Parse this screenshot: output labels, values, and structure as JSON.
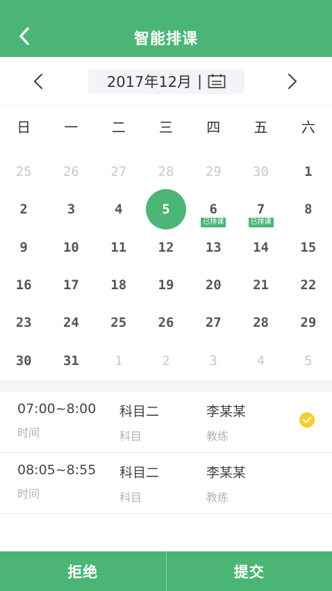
{
  "header": {
    "title": "智能排课"
  },
  "month_bar": {
    "year_month": "2017年12月",
    "separator": "|"
  },
  "weekdays": [
    "日",
    "一",
    "二",
    "三",
    "四",
    "五",
    "六"
  ],
  "calendar": {
    "selected_day": "5",
    "badge_label": "已排课",
    "weeks": [
      [
        {
          "d": "25",
          "other": true
        },
        {
          "d": "26",
          "other": true
        },
        {
          "d": "27",
          "other": true
        },
        {
          "d": "28",
          "other": true
        },
        {
          "d": "29",
          "other": true
        },
        {
          "d": "30",
          "other": true
        },
        {
          "d": "1"
        }
      ],
      [
        {
          "d": "2"
        },
        {
          "d": "3"
        },
        {
          "d": "4"
        },
        {
          "d": "5",
          "selected": true
        },
        {
          "d": "6",
          "badge": "已排课"
        },
        {
          "d": "7",
          "badge": "已排课"
        },
        {
          "d": "8"
        }
      ],
      [
        {
          "d": "9"
        },
        {
          "d": "10"
        },
        {
          "d": "11"
        },
        {
          "d": "12"
        },
        {
          "d": "13"
        },
        {
          "d": "14"
        },
        {
          "d": "15"
        }
      ],
      [
        {
          "d": "16"
        },
        {
          "d": "17"
        },
        {
          "d": "18"
        },
        {
          "d": "19"
        },
        {
          "d": "20"
        },
        {
          "d": "21"
        },
        {
          "d": "22"
        }
      ],
      [
        {
          "d": "23"
        },
        {
          "d": "24"
        },
        {
          "d": "25"
        },
        {
          "d": "26"
        },
        {
          "d": "27"
        },
        {
          "d": "28"
        },
        {
          "d": "29"
        }
      ],
      [
        {
          "d": "30"
        },
        {
          "d": "31"
        },
        {
          "d": "1",
          "other": true
        },
        {
          "d": "2",
          "other": true
        },
        {
          "d": "3",
          "other": true
        },
        {
          "d": "4",
          "other": true
        },
        {
          "d": "5",
          "other": true
        }
      ]
    ]
  },
  "slots": [
    {
      "time": "07:00~8:00",
      "time_label": "时间",
      "subject": "科目二",
      "subject_label": "科目",
      "coach": "李某某",
      "coach_label": "教练",
      "checked": true
    },
    {
      "time": "08:05~8:55",
      "time_label": "时间",
      "subject": "科目二",
      "subject_label": "科目",
      "coach": "李某某",
      "coach_label": "教练",
      "checked": false
    }
  ],
  "footer": {
    "reject_label": "拒绝",
    "submit_label": "提交"
  },
  "colors": {
    "primary": "#4bb575",
    "check": "#f6cd2b",
    "muted_text": "#b3b3b3",
    "panel_bg": "#f2f4f7"
  }
}
